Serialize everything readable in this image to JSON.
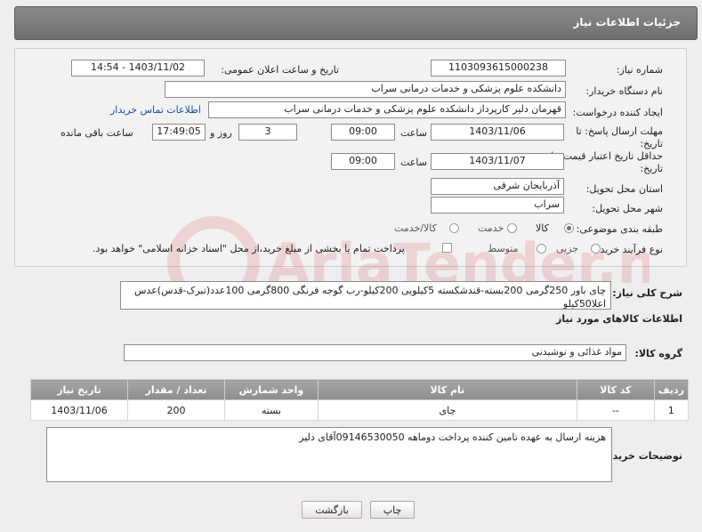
{
  "header": {
    "title": "جزئیات اطلاعات نیاز"
  },
  "form": {
    "need_number": {
      "label": "شماره نیاز:",
      "value": "1103093615000238"
    },
    "announce_datetime": {
      "label": "تاریخ و ساعت اعلان عمومی:",
      "value": "1403/11/02 - 14:54"
    },
    "buyer_org": {
      "label": "نام دستگاه خریدار:",
      "value": "دانشکده علوم پزشکی و خدمات درمانی سراب"
    },
    "requester": {
      "label": "ایجاد کننده درخواست:",
      "value": "قهرمان دلیر کارپرداز دانشکده علوم پزشکی و خدمات درمانی سراب",
      "contact_link": "اطلاعات تماس خریدار"
    },
    "reply_deadline": {
      "label_line1": "مهلت ارسال پاسخ: تا",
      "label_line2": "تاریخ:",
      "date": "1403/11/06",
      "time_label": "ساعت",
      "time": "09:00",
      "days": "3",
      "days_label": "روز و",
      "remaining": "17:49:05",
      "remaining_label": "ساعت باقی مانده"
    },
    "price_validity": {
      "label_line1": "حداقل تاریخ اعتبار قیمت: تا",
      "label_line2": "تاریخ:",
      "date": "1403/11/07",
      "time_label": "ساعت",
      "time": "09:00"
    },
    "delivery_province": {
      "label": "استان محل تحویل:",
      "value": "آذربایجان شرقی"
    },
    "delivery_city": {
      "label": "شهر محل تحویل:",
      "value": "سراب"
    },
    "category": {
      "label": "طبقه بندی موضوعی:",
      "options": [
        "کالا",
        "خدمت",
        "کالا/خدمت"
      ],
      "selected": "کالا"
    },
    "purchase_type": {
      "label": "نوع فرآیند خرید :",
      "options": [
        "جزیی",
        "متوسط"
      ],
      "note": "پرداخت تمام یا بخشی از مبلغ خرید،از محل \"اسناد خزانه اسلامی\" خواهد بود."
    }
  },
  "description": {
    "label": "شرح کلی نیاز:",
    "value": "چای باور 250گرمی 200بسته-قندشکسته 5کیلویی 200کیلو-رب گوجه فرنگی 800گرمی 100عدد(تبرک-قدس)عدس اعلا50کیلو"
  },
  "goods_section": {
    "title": "اطلاعات کالاهای مورد نیاز"
  },
  "goods_group": {
    "label": "گروه کالا:",
    "value": "مواد غذائی و نوشیدنی"
  },
  "table": {
    "headers": [
      "ردیف",
      "کد کالا",
      "نام کالا",
      "واحد شمارش",
      "تعداد / مقدار",
      "تاریخ نیاز"
    ],
    "rows": [
      [
        "1",
        "--",
        "چای",
        "بسته",
        "200",
        "1403/11/06"
      ]
    ]
  },
  "buyer_notes": {
    "label": "توضیحات خریدار:",
    "value": "هزینه ارسال به عهده تامین کننده پرداخت دوماهه 09146530050آقای دلیر"
  },
  "buttons": {
    "print": "چاپ",
    "back": "بازگشت"
  },
  "watermark": {
    "text": "AriaTender.neT"
  }
}
